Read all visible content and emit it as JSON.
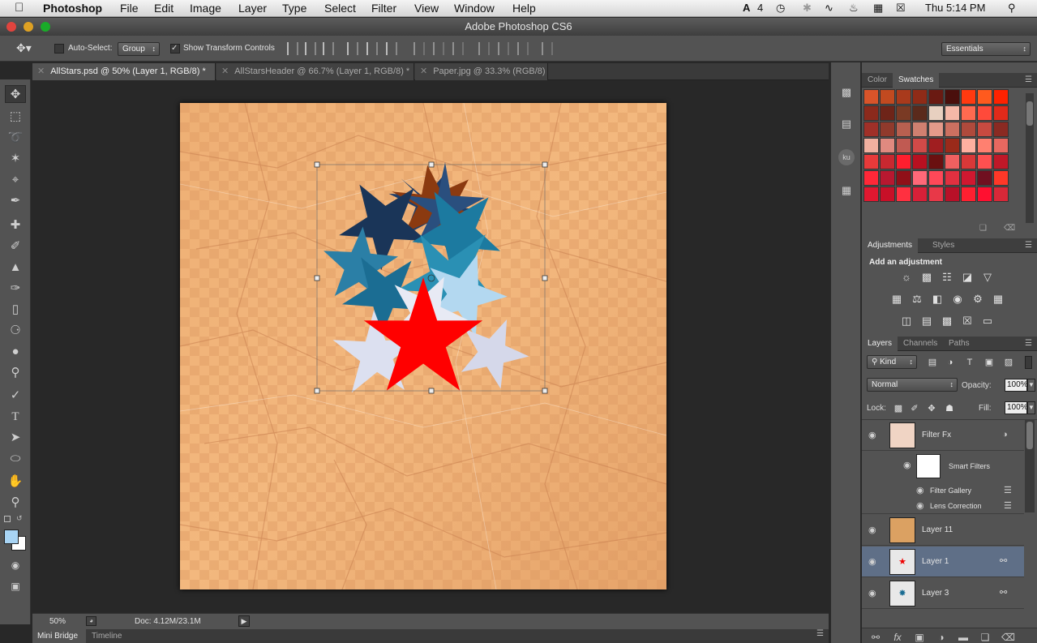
{
  "menubar": {
    "app": "Photoshop",
    "items": [
      "File",
      "Edit",
      "Image",
      "Layer",
      "Type",
      "Select",
      "Filter",
      "View",
      "Window",
      "Help"
    ],
    "status_number": "4",
    "clock": "Thu 5:14 PM"
  },
  "window": {
    "title": "Adobe Photoshop CS6"
  },
  "options": {
    "auto_select_label": "Auto-Select:",
    "auto_select_value": "Group",
    "show_transform_label": "Show Transform Controls",
    "workspace": "Essentials"
  },
  "doc_tabs": [
    {
      "label": "AllStars.psd @ 50% (Layer 1, RGB/8) *"
    },
    {
      "label": "AllStarsHeader @ 66.7% (Layer 1, RGB/8) *"
    },
    {
      "label": "Paper.jpg @ 33.3% (RGB/8)"
    }
  ],
  "status": {
    "zoom": "50%",
    "doc": "Doc: 4.12M/23.1M"
  },
  "bottom_tabs": [
    "Mini Bridge",
    "Timeline"
  ],
  "panels": {
    "color_tab": "Color",
    "swatches_tab": "Swatches",
    "adjustments_tab": "Adjustments",
    "styles_tab": "Styles",
    "add_adjustment": "Add an adjustment",
    "layers_tab": "Layers",
    "channels_tab": "Channels",
    "paths_tab": "Paths",
    "kind": "Kind",
    "blend_mode": "Normal",
    "opacity_label": "Opacity:",
    "opacity": "100%",
    "lock_label": "Lock:",
    "fill_label": "Fill:",
    "fill": "100%"
  },
  "swatch_colors": [
    "#d9542a",
    "#c24a20",
    "#a93a1c",
    "#8f2b17",
    "#6a1a12",
    "#4a0f0c",
    "#ff3a10",
    "#ff5a1e",
    "#ff2200",
    "#8b2a1c",
    "#6e2418",
    "#7a3a24",
    "#5a2a1c",
    "#e8d0c0",
    "#f5b8a8",
    "#ff6a50",
    "#ff4a3a",
    "#e02a1a",
    "#a03028",
    "#903a2c",
    "#b86050",
    "#d08070",
    "#e49a8a",
    "#cc7060",
    "#b04a3c",
    "#c84a40",
    "#8a2a22",
    "#f0b0a0",
    "#e08a80",
    "#c05a52",
    "#d04a48",
    "#a01e20",
    "#9a2a1a",
    "#ffb0a0",
    "#ff8070",
    "#e86860",
    "#e83a3a",
    "#c82830",
    "#ff1e2e",
    "#b81020",
    "#6a1010",
    "#f06060",
    "#d83838",
    "#ff5050",
    "#c01828",
    "#ff2838",
    "#b81830",
    "#901018",
    "#ff6878",
    "#ff4858",
    "#e03040",
    "#d01830",
    "#701020",
    "#ff3828",
    "#e01830",
    "#c81028",
    "#ff3040",
    "#d82038",
    "#e83848",
    "#b81028",
    "#ff2030",
    "#ff1030",
    "#d82838"
  ],
  "layers": [
    {
      "name": "Filter Fx"
    },
    {
      "name": "Smart Filters"
    },
    {
      "name": "Filter Gallery"
    },
    {
      "name": "Lens Correction"
    },
    {
      "name": "Layer 11"
    },
    {
      "name": "Layer 1"
    },
    {
      "name": "Layer 3"
    }
  ]
}
